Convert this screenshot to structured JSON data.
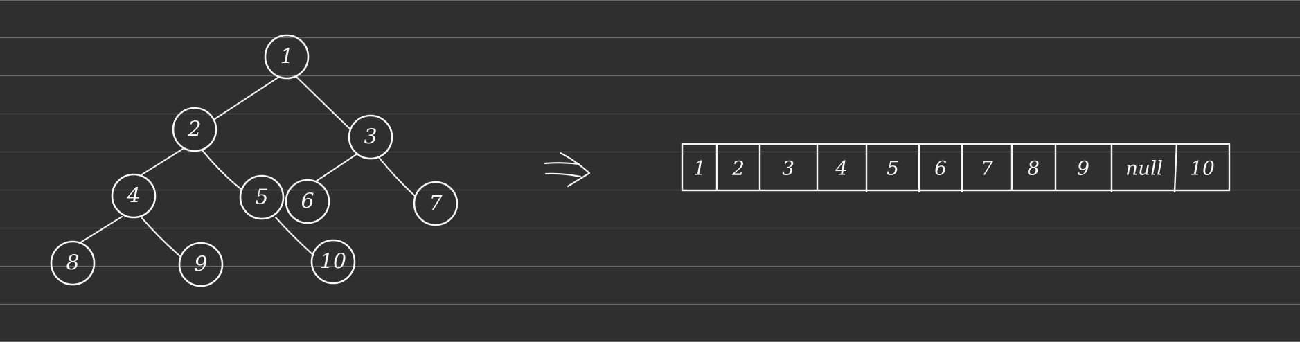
{
  "tree": {
    "nodes": [
      {
        "id": "n1",
        "label": "1"
      },
      {
        "id": "n2",
        "label": "2"
      },
      {
        "id": "n3",
        "label": "3"
      },
      {
        "id": "n4",
        "label": "4"
      },
      {
        "id": "n5",
        "label": "5"
      },
      {
        "id": "n6",
        "label": "6"
      },
      {
        "id": "n7",
        "label": "7"
      },
      {
        "id": "n8",
        "label": "8"
      },
      {
        "id": "n9",
        "label": "9"
      },
      {
        "id": "n10",
        "label": "10"
      }
    ],
    "edges": [
      [
        "n1",
        "n2"
      ],
      [
        "n1",
        "n3"
      ],
      [
        "n2",
        "n4"
      ],
      [
        "n2",
        "n5"
      ],
      [
        "n3",
        "n6"
      ],
      [
        "n3",
        "n7"
      ],
      [
        "n4",
        "n8"
      ],
      [
        "n4",
        "n9"
      ],
      [
        "n5",
        "n10"
      ]
    ]
  },
  "array": {
    "cells": [
      "1",
      "2",
      "3",
      "4",
      "5",
      "6",
      "7",
      "8",
      "9",
      "null",
      "10"
    ]
  }
}
